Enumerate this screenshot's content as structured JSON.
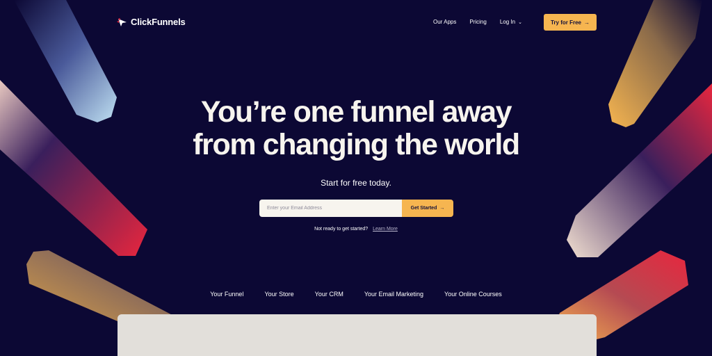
{
  "brand": {
    "name": "ClickFunnels",
    "logo_icon": "clickfunnels-logo-icon",
    "accent": "#f6b550",
    "background": "#0c0834"
  },
  "nav": {
    "links": [
      {
        "label": "Our Apps"
      },
      {
        "label": "Pricing"
      },
      {
        "label": "Log In",
        "icon": "chevron-down-icon"
      }
    ],
    "cta_label": "Try for Free",
    "cta_icon": "→"
  },
  "hero": {
    "headline_line1": "You’re one funnel away",
    "headline_line2": "from changing the world",
    "subheading": "Start for free today."
  },
  "signup": {
    "email_placeholder": "Enter your Email Address",
    "email_value": "",
    "button_label": "Get Started",
    "button_icon": "→"
  },
  "secondary": {
    "prompt": "Not ready to get started?",
    "link_label": "Learn More"
  },
  "tabs": [
    {
      "label": "Your Funnel"
    },
    {
      "label": "Your Store"
    },
    {
      "label": "Your CRM"
    },
    {
      "label": "Your Email Marketing"
    },
    {
      "label": "Your Online Courses"
    }
  ]
}
